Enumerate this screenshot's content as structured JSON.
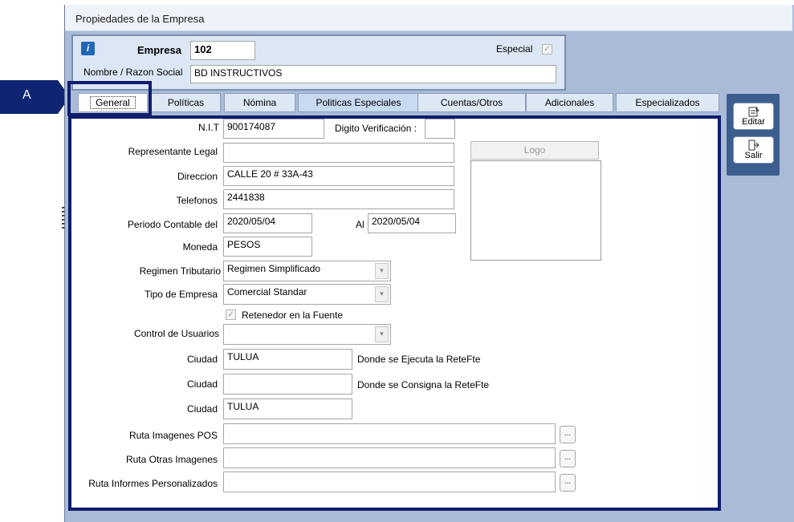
{
  "window": {
    "title": "Propiedades de la Empresa"
  },
  "marker": {
    "label": "A"
  },
  "header": {
    "company_label": "Empresa",
    "company_value": "102",
    "special_label": "Especial",
    "name_label": "Nombre / Razon Social",
    "name_value": "BD INSTRUCTIVOS"
  },
  "tabs": [
    {
      "label": "General"
    },
    {
      "label": "Políticas"
    },
    {
      "label": "Nómina"
    },
    {
      "label": "Politicas Especiales"
    },
    {
      "label": "Cuentas/Otros"
    },
    {
      "label": "Adicionales"
    },
    {
      "label": "Especializados"
    }
  ],
  "side_buttons": {
    "edit": "Editar",
    "exit": "Salir"
  },
  "form": {
    "nit_label": "N.I.T",
    "nit_value": "900174087",
    "digit_label": "Digito Verificación :",
    "digit_value": "",
    "rep_label": "Representante Legal",
    "rep_value": "",
    "address_label": "Direccion",
    "address_value": "CALLE 20 # 33A-43",
    "phone_label": "Telefonos",
    "phone_value": "2441838",
    "period_label": "Periodo Contable del",
    "period_from": "2020/05/04",
    "period_to_label": "Al",
    "period_to": "2020/05/04",
    "currency_label": "Moneda",
    "currency_value": "PESOS",
    "regime_label": "Regimen Tributario",
    "regime_value": "Regimen Simplificado",
    "type_label": "Tipo de Empresa",
    "type_value": "Comercial Standar",
    "withholder_label": "Retenedor en la Fuente",
    "users_label": "Control de Usuarios",
    "users_value": "",
    "city1_label": "Ciudad",
    "city1_value": "TULUA",
    "city1_note": "Donde se Ejecuta  la ReteFte",
    "city2_label": "Ciudad",
    "city2_value": "",
    "city2_note": "Donde se Consigna la ReteFte",
    "city3_label": "Ciudad",
    "city3_value": "TULUA",
    "pos_images_label": "Ruta Imagenes POS",
    "other_images_label": "Ruta Otras Imagenes",
    "reports_label": "Ruta Informes Personalizados",
    "browse_label": "...",
    "logo_label": "Logo"
  }
}
